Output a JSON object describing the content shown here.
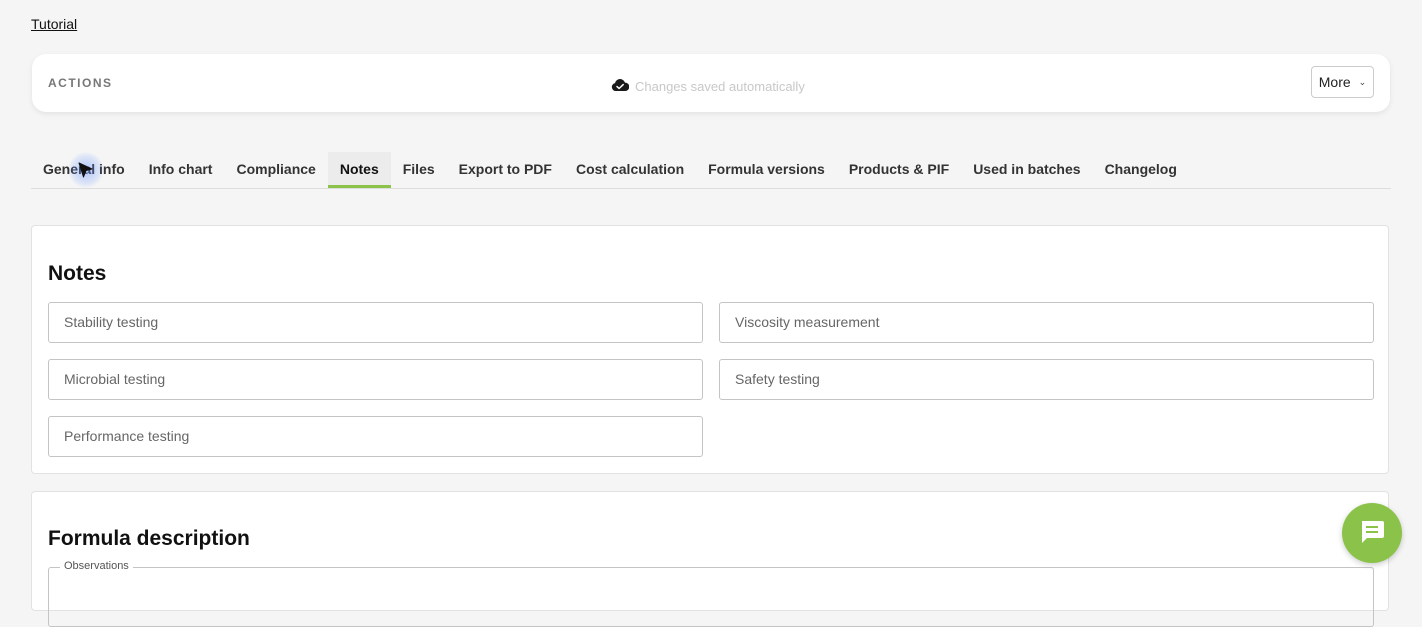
{
  "header": {
    "tutorial_link": "Tutorial"
  },
  "actions": {
    "label": "ACTIONS",
    "save_status": "Changes saved automatically",
    "more_label": "More"
  },
  "tabs": [
    {
      "label": "General info"
    },
    {
      "label": "Info chart"
    },
    {
      "label": "Compliance"
    },
    {
      "label": "Notes",
      "active": true
    },
    {
      "label": "Files"
    },
    {
      "label": "Export to PDF"
    },
    {
      "label": "Cost calculation"
    },
    {
      "label": "Formula versions"
    },
    {
      "label": "Products & PIF"
    },
    {
      "label": "Used in batches"
    },
    {
      "label": "Changelog"
    }
  ],
  "notes": {
    "title": "Notes",
    "fields": [
      {
        "placeholder": "Stability testing"
      },
      {
        "placeholder": "Viscosity measurement"
      },
      {
        "placeholder": "Microbial testing"
      },
      {
        "placeholder": "Safety testing"
      },
      {
        "placeholder": "Performance testing"
      }
    ]
  },
  "formula": {
    "title": "Formula description",
    "observations_label": "Observations"
  },
  "colors": {
    "accent": "#8bc34a",
    "background": "#f5f5f5",
    "muted_text": "#c8c8c8"
  },
  "icons": {
    "save": "cloud-check-icon",
    "more": "chevron-down-icon",
    "chat": "chat-icon",
    "cursor": "mouse-pointer-icon"
  }
}
